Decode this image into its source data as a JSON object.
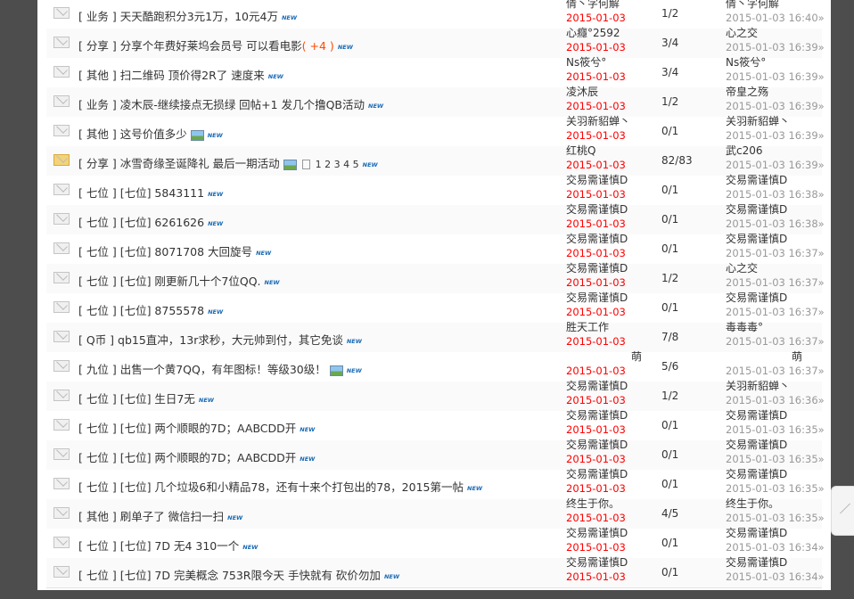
{
  "new_label": "NEW",
  "threads": [
    {
      "cat": "[ 业务 ]",
      "title": "天天酷跑积分3元1万，10元4万",
      "plus": "",
      "img": false,
      "pages": "",
      "hot": false,
      "author": "倩丶字何解",
      "date": "2015-01-03",
      "nums": "1/2",
      "last_by": "倩丶字何解",
      "last_time": "2015-01-03 16:40»"
    },
    {
      "cat": "[ 分享 ]",
      "title": "分享个年费好莱坞会员号 可以看电影",
      "plus": "( +4 )",
      "img": false,
      "pages": "",
      "hot": false,
      "author": "心癮°2592",
      "date": "2015-01-03",
      "nums": "3/4",
      "last_by": "心之交",
      "last_time": "2015-01-03 16:39»"
    },
    {
      "cat": "[ 其他 ]",
      "title": "扫二维码 顶价得2R了 速度来",
      "plus": "",
      "img": false,
      "pages": "",
      "hot": false,
      "author": "Ns筱兮°",
      "date": "2015-01-03",
      "nums": "3/4",
      "last_by": "Ns筱兮°",
      "last_time": "2015-01-03 16:39»"
    },
    {
      "cat": "[ 业务 ]",
      "title": "凌木辰-继续接点无损绿 回帖+1 发几个撸QB活动",
      "plus": "",
      "img": false,
      "pages": "",
      "hot": false,
      "author": "凌沐辰",
      "date": "2015-01-03",
      "nums": "1/2",
      "last_by": "帝皇之殇",
      "last_time": "2015-01-03 16:39»"
    },
    {
      "cat": "[ 其他 ]",
      "title": "这号价值多少",
      "plus": "",
      "img": true,
      "pages": "",
      "hot": false,
      "author": "关羽新貂蝉丶",
      "date": "2015-01-03",
      "nums": "0/1",
      "last_by": "关羽新貂蝉丶",
      "last_time": "2015-01-03 16:39»"
    },
    {
      "cat": "[ 分享 ]",
      "title": "冰雪奇缘圣诞降礼 最后一期活动",
      "plus": "",
      "img": true,
      "pages": "1 2 3 4 5",
      "hot": true,
      "author": "红桃Q",
      "date": "2015-01-03",
      "nums": "82/83",
      "last_by": "武c206",
      "last_time": "2015-01-03 16:39»"
    },
    {
      "cat": "[ 七位 ]",
      "title": "[七位] 5843111",
      "plus": "",
      "img": false,
      "pages": "",
      "hot": false,
      "author": "交易需谨慎D",
      "date": "2015-01-03",
      "nums": "0/1",
      "last_by": "交易需谨慎D",
      "last_time": "2015-01-03 16:38»"
    },
    {
      "cat": "[ 七位 ]",
      "title": "[七位] 6261626",
      "plus": "",
      "img": false,
      "pages": "",
      "hot": false,
      "author": "交易需谨慎D",
      "date": "2015-01-03",
      "nums": "0/1",
      "last_by": "交易需谨慎D",
      "last_time": "2015-01-03 16:38»"
    },
    {
      "cat": "[ 七位 ]",
      "title": "[七位] 8071708 大回旋号",
      "plus": "",
      "img": false,
      "pages": "",
      "hot": false,
      "author": "交易需谨慎D",
      "date": "2015-01-03",
      "nums": "0/1",
      "last_by": "交易需谨慎D",
      "last_time": "2015-01-03 16:37»"
    },
    {
      "cat": "[ 七位 ]",
      "title": "[七位] 刚更新几十个7位QQ.",
      "plus": "",
      "img": false,
      "pages": "",
      "hot": false,
      "author": "交易需谨慎D",
      "date": "2015-01-03",
      "nums": "1/2",
      "last_by": "心之交",
      "last_time": "2015-01-03 16:37»"
    },
    {
      "cat": "[ 七位 ]",
      "title": "[七位] 8755578",
      "plus": "",
      "img": false,
      "pages": "",
      "hot": false,
      "author": "交易需谨慎D",
      "date": "2015-01-03",
      "nums": "0/1",
      "last_by": "交易需谨慎D",
      "last_time": "2015-01-03 16:37»"
    },
    {
      "cat": "[ Q币 ]",
      "title": "qb15直冲，13r求秒，大元帅到付，其它免谈",
      "plus": "",
      "img": false,
      "pages": "",
      "hot": false,
      "author": "胜天工作",
      "date": "2015-01-03",
      "nums": "7/8",
      "last_by": "毒毒毒°",
      "last_time": "2015-01-03 16:37»"
    },
    {
      "cat": "[ 九位 ]",
      "title": "出售一个黄7QQ，有年图标！等级30级！",
      "plus": "",
      "img": true,
      "pages": "",
      "hot": false,
      "author": "萌",
      "date": "2015-01-03",
      "nums": "5/6",
      "last_by": "萌",
      "last_time": "2015-01-03 16:37»",
      "right_name": true
    },
    {
      "cat": "[ 七位 ]",
      "title": "[七位] 生日7无",
      "plus": "",
      "img": false,
      "pages": "",
      "hot": false,
      "author": "交易需谨慎D",
      "date": "2015-01-03",
      "nums": "1/2",
      "last_by": "关羽新貂蝉丶",
      "last_time": "2015-01-03 16:36»"
    },
    {
      "cat": "[ 七位 ]",
      "title": "[七位] 两个顺眼的7D；AABCDD开",
      "plus": "",
      "img": false,
      "pages": "",
      "hot": false,
      "author": "交易需谨慎D",
      "date": "2015-01-03",
      "nums": "0/1",
      "last_by": "交易需谨慎D",
      "last_time": "2015-01-03 16:35»"
    },
    {
      "cat": "[ 七位 ]",
      "title": "[七位] 两个顺眼的7D；AABCDD开",
      "plus": "",
      "img": false,
      "pages": "",
      "hot": false,
      "author": "交易需谨慎D",
      "date": "2015-01-03",
      "nums": "0/1",
      "last_by": "交易需谨慎D",
      "last_time": "2015-01-03 16:35»"
    },
    {
      "cat": "[ 七位 ]",
      "title": "[七位] 几个垃圾6和小精品78，还有十来个打包出的78，2015第一帖",
      "plus": "",
      "img": false,
      "pages": "",
      "hot": false,
      "author": "交易需谨慎D",
      "date": "2015-01-03",
      "nums": "0/1",
      "last_by": "交易需谨慎D",
      "last_time": "2015-01-03 16:35»"
    },
    {
      "cat": "[ 其他 ]",
      "title": "刷单子了  微信扫一扫",
      "plus": "",
      "img": false,
      "pages": "",
      "hot": false,
      "author": "终生于你。",
      "date": "2015-01-03",
      "nums": "4/5",
      "last_by": "终生于你。",
      "last_time": "2015-01-03 16:35»"
    },
    {
      "cat": "[ 七位 ]",
      "title": "[七位] 7D 无4 310一个",
      "plus": "",
      "img": false,
      "pages": "",
      "hot": false,
      "author": "交易需谨慎D",
      "date": "2015-01-03",
      "nums": "0/1",
      "last_by": "交易需谨慎D",
      "last_time": "2015-01-03 16:34»"
    },
    {
      "cat": "[ 七位 ]",
      "title": "[七位] 7D 完美概念 753R限今天 手快就有 砍价勿加",
      "plus": "",
      "img": false,
      "pages": "",
      "hot": false,
      "author": "交易需谨慎D",
      "date": "2015-01-03",
      "nums": "0/1",
      "last_by": "交易需谨慎D",
      "last_time": "2015-01-03 16:34»"
    }
  ]
}
